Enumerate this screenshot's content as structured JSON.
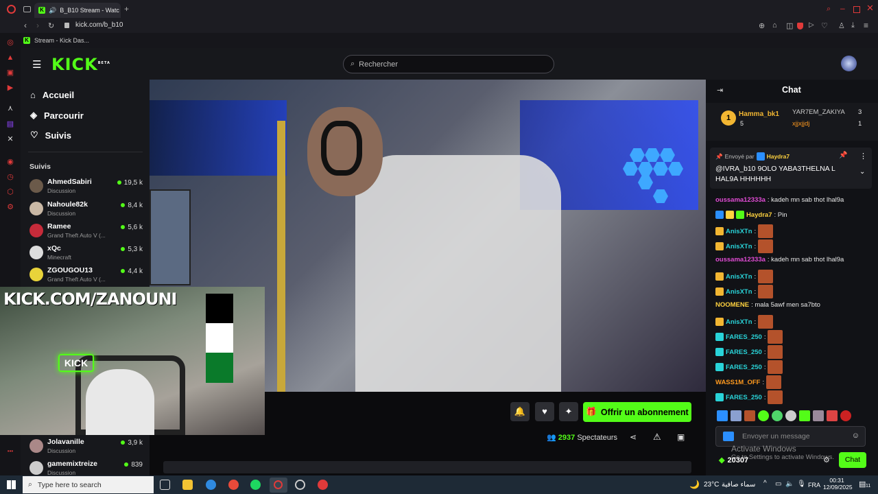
{
  "browser": {
    "tab_title": "B_B10 Stream - Watc",
    "url": "kick.com/b_b10",
    "bookmark": "Stream - Kick Das..."
  },
  "header": {
    "logo": "KICK",
    "logo_beta": "BETA",
    "search_placeholder": "Rechercher"
  },
  "nav": {
    "home": "Accueil",
    "browse": "Parcourir",
    "following": "Suivis",
    "section_title": "Suivis"
  },
  "followed": [
    {
      "name": "AhmedSabiri",
      "category": "Discussion",
      "viewers": "19,5 k"
    },
    {
      "name": "Nahoule82k",
      "category": "Discussion",
      "viewers": "8,4 k"
    },
    {
      "name": "Ramee",
      "category": "Grand Theft Auto V (...",
      "viewers": "5,6 k"
    },
    {
      "name": "xQc",
      "category": "Minecraft",
      "viewers": "5,3 k"
    },
    {
      "name": "ZGOUGOU13",
      "category": "Grand Theft Auto V (...",
      "viewers": "4,4 k"
    },
    {
      "name": "Jolavanille",
      "category": "Discussion",
      "viewers": "3,9 k"
    },
    {
      "name": "gamemixtreize",
      "category": "Discussion",
      "viewers": "839"
    }
  ],
  "webcam": {
    "overlay_text": "KICK.COM/ZANOUNI",
    "sign_text": "KICK"
  },
  "stream": {
    "subscribe_label": "Offrir un abonnement",
    "viewers_count": "2937",
    "viewers_label": "Spectateurs"
  },
  "chat": {
    "title": "Chat",
    "leaderboard": [
      {
        "rank": "1",
        "name": "Hamma_bk1",
        "count": "5"
      },
      {
        "name": "YAR7EM_ZAKIYA",
        "count": "3"
      },
      {
        "name": "xjjxjjdj",
        "count": "1"
      }
    ],
    "pinned": {
      "sent_by_label": "Envoyé par",
      "sender": "Haydra7",
      "text_line1": "@IVRA_b10 9OLO YABA3THELNA L",
      "text_line2": "HAL9A HHHHHH"
    },
    "messages": [
      {
        "user": "oussama12333a",
        "text": ": kadeh mn sab thot lhal9a",
        "color": "pink"
      },
      {
        "user": "Haydra7",
        "text": ": Pin",
        "color": "yellow"
      },
      {
        "user": "AnisXTn",
        "text": ":",
        "color": "cyan"
      },
      {
        "user": "AnisXTn",
        "text": ":",
        "color": "cyan"
      },
      {
        "user": "oussama12333a",
        "text": ": kadeh mn sab thot lhal9a",
        "color": "pink"
      },
      {
        "user": "AnisXTn",
        "text": ":",
        "color": "cyan"
      },
      {
        "user": "AnisXTn",
        "text": ":",
        "color": "cyan"
      },
      {
        "user": "NOOMENE",
        "text": ": mala 5awf men sa7bto",
        "color": "yellow"
      },
      {
        "user": "AnisXTn",
        "text": ":",
        "color": "cyan"
      },
      {
        "user": "FARES_250",
        "text": ":",
        "color": "cyan"
      },
      {
        "user": "FARES_250",
        "text": ":",
        "color": "cyan"
      },
      {
        "user": "FARES_250",
        "text": ":",
        "color": "cyan"
      },
      {
        "user": "WASS1M_OFF",
        "text": ":",
        "color": "orange"
      },
      {
        "user": "FARES_250",
        "text": ":",
        "color": "cyan"
      }
    ],
    "input_placeholder": "Envoyer un message",
    "points": "20307",
    "send_label": "Chat",
    "watermark_line1": "Activate Windows",
    "watermark_line2": "Go to Settings to activate Windows."
  },
  "taskbar": {
    "search_placeholder": "Type here to search",
    "temperature": "23°C",
    "weather": "سماء صافية",
    "language": "FRA",
    "time": "00:31",
    "date": "12/09/2025",
    "notification_count": "11"
  },
  "colors": {
    "kick_green": "#53fc18",
    "background": "#0b0b0d",
    "panel": "#17181c"
  }
}
